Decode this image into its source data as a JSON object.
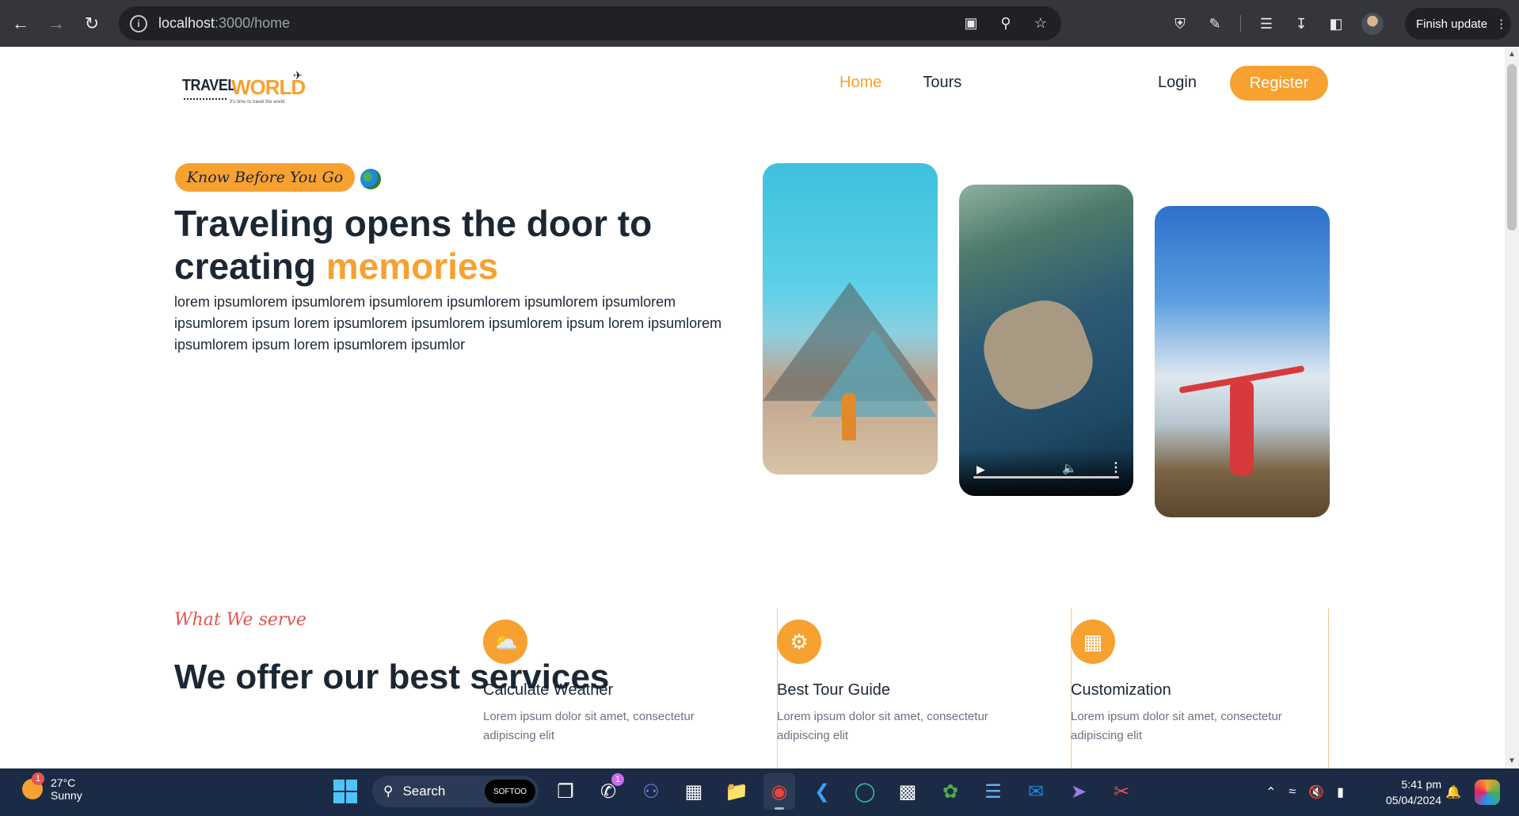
{
  "browser": {
    "url_host": "localhost",
    "url_path": ":3000/home",
    "finish_update_label": "Finish update"
  },
  "site": {
    "logo_travel": "TRAVEL",
    "logo_world": "WORLD",
    "logo_tagline": "It's time to travel the world",
    "nav": [
      {
        "label": "Home",
        "active": true
      },
      {
        "label": "Tours",
        "active": false
      }
    ],
    "login_label": "Login",
    "register_label": "Register"
  },
  "hero": {
    "badge": "Know Before You Go",
    "title_part1": "Traveling opens the door to creating",
    "title_accent": "memories",
    "text": "lorem ipsumlorem ipsumlorem ipsumlorem ipsumlorem ipsumlorem ipsumlorem ipsumlorem ipsum lorem ipsumlorem ipsumlorem ipsumlorem ipsum lorem ipsumlorem ipsumlorem ipsum lorem ipsumlorem ipsumlor"
  },
  "services": {
    "subtitle": "What We serve",
    "title": "We offer our best services",
    "items": [
      {
        "title": "Calculate Weather",
        "text": "Lorem ipsum dolor sit amet, consectetur adipiscing elit",
        "icon": "weather-icon"
      },
      {
        "title": "Best Tour Guide",
        "text": "Lorem ipsum dolor sit amet, consectetur adipiscing elit",
        "icon": "guide-icon"
      },
      {
        "title": "Customization",
        "text": "Lorem ipsum dolor sit amet, consectetur adipiscing elit",
        "icon": "customization-icon"
      }
    ]
  },
  "taskbar": {
    "weather_temp": "27°C",
    "weather_desc": "Sunny",
    "weather_badge": "1",
    "search_label": "Search",
    "softoo_label": "SOFTOO",
    "whatsapp_badge": "1",
    "time": "5:41 pm",
    "date": "05/04/2024"
  },
  "colors": {
    "accent": "#f7a130",
    "subtitle_red": "#e5554f",
    "text_dark": "#1b2733"
  }
}
